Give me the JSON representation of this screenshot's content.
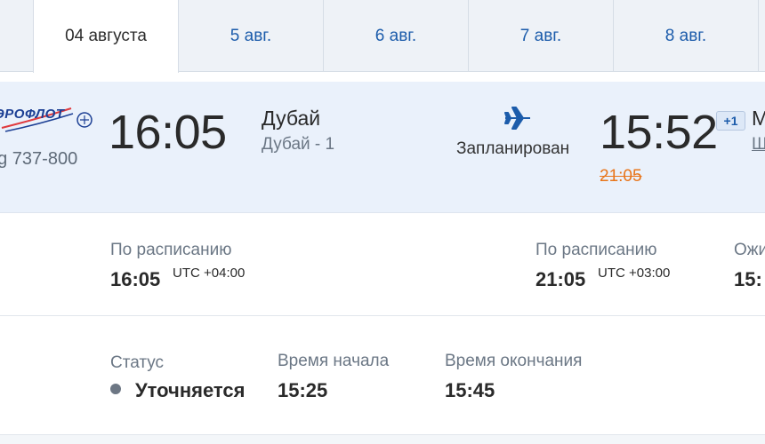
{
  "tabs": [
    {
      "label": "04 августа",
      "active": true
    },
    {
      "label": "5 авг.",
      "active": false
    },
    {
      "label": "6 авг.",
      "active": false
    },
    {
      "label": "7 авг.",
      "active": false
    },
    {
      "label": "8 авг.",
      "active": false
    }
  ],
  "flight": {
    "airline_logo_text": "ЭРОФЛОТ",
    "aircraft": "ng 737-800",
    "departure": {
      "time": "16:05",
      "city": "Дубай",
      "terminal": "Дубай - 1"
    },
    "plane_icon": "plane-icon",
    "status": "Запланирован",
    "arrival": {
      "time": "15:52",
      "old_time": "21:05",
      "day_offset": "+1",
      "city": "М",
      "terminal": "Ш"
    }
  },
  "schedule": {
    "departure": {
      "label": "По расписанию",
      "time": "16:05",
      "tz": "UTC +04:00"
    },
    "arrival": {
      "label": "По расписанию",
      "time": "21:05",
      "tz": "UTC +03:00"
    },
    "expected": {
      "label": "Ожи",
      "time": "15:"
    }
  },
  "boarding": {
    "status_label": "Статус",
    "status_value": "Уточняется",
    "start_label": "Время начала",
    "start_value": "15:25",
    "end_label": "Время окончания",
    "end_value": "15:45"
  },
  "colors": {
    "accent": "#1c5cab",
    "delay": "#e8751a",
    "row_bg": "#eaf1fb"
  }
}
